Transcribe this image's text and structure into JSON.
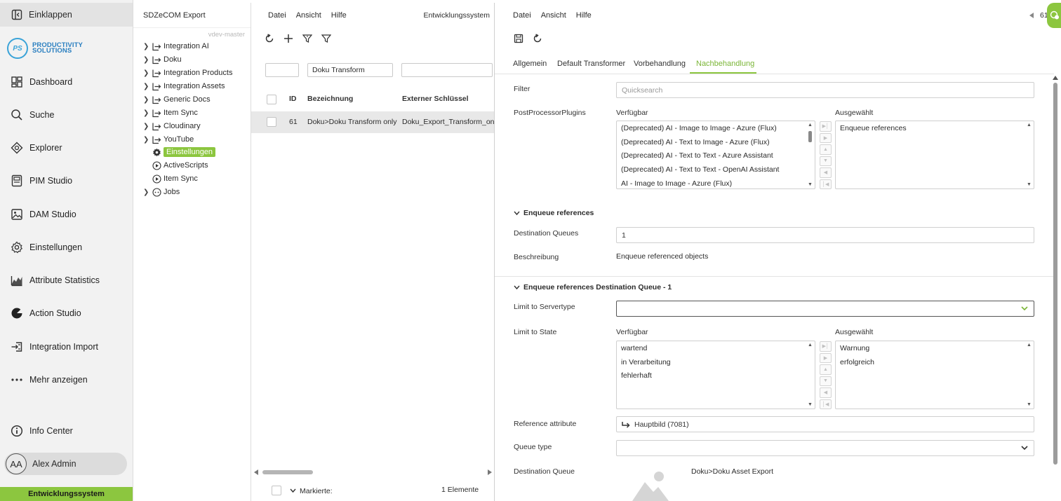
{
  "nav": {
    "collapse_label": "Einklappen",
    "logo_initials": "PS",
    "logo_line1": "PRODUCTIVITY",
    "logo_line2": "SOLUTIONS",
    "items": [
      {
        "label": "Dashboard",
        "icon": "dashboard-icon"
      },
      {
        "label": "Suche",
        "icon": "search-icon"
      },
      {
        "label": "Explorer",
        "icon": "explorer-icon"
      },
      {
        "label": "PIM Studio",
        "icon": "pim-studio-icon"
      },
      {
        "label": "DAM Studio",
        "icon": "image-icon"
      },
      {
        "label": "Einstellungen",
        "icon": "gear-icon"
      },
      {
        "label": "Attribute Statistics",
        "icon": "chart-icon"
      },
      {
        "label": "Action Studio",
        "icon": "action-studio-icon"
      },
      {
        "label": "Integration Import",
        "icon": "import-icon"
      },
      {
        "label": "Mehr anzeigen",
        "icon": "more-icon"
      }
    ],
    "info_center": "Info Center",
    "user_initials": "AA",
    "user_name": "Alex Admin",
    "environment": "Entwicklungssystem"
  },
  "tree": {
    "title": "SDZeCOM Export",
    "branch": "vdev-master",
    "items": [
      {
        "label": "Integration AI",
        "type": "folder"
      },
      {
        "label": "Doku",
        "type": "folder"
      },
      {
        "label": "Integration Products",
        "type": "folder"
      },
      {
        "label": "Integration Assets",
        "type": "folder"
      },
      {
        "label": "Generic Docs",
        "type": "folder"
      },
      {
        "label": "Item Sync",
        "type": "folder"
      },
      {
        "label": "Cloudinary",
        "type": "folder"
      },
      {
        "label": "YouTube",
        "type": "folder"
      },
      {
        "label": "Einstellungen",
        "type": "settings",
        "selected": true
      },
      {
        "label": "ActiveScripts",
        "type": "play"
      },
      {
        "label": "Item Sync",
        "type": "play"
      },
      {
        "label": "Jobs",
        "type": "jobs"
      }
    ]
  },
  "list": {
    "menu": [
      "Datei",
      "Ansicht",
      "Hilfe"
    ],
    "environment": "Entwicklungssystem",
    "filter_id": "",
    "filter_name": "Doku Transform",
    "filter_key": "",
    "columns": {
      "id": "ID",
      "name": "Bezeichnung",
      "key": "Externer Schlüssel"
    },
    "rows": [
      {
        "id": "61",
        "name": "Doku>Doku Transform only",
        "key": "Doku_Export_Transform_only"
      }
    ],
    "footer_marked": "Markierte:",
    "footer_count": "1 Elemente"
  },
  "detail": {
    "menu": [
      "Datei",
      "Ansicht",
      "Hilfe"
    ],
    "record_id": "61",
    "tabs": [
      "Allgemein",
      "Default Transformer",
      "Vorbehandlung",
      "Nachbehandlung"
    ],
    "active_tab": "Nachbehandlung",
    "filter_label": "Filter",
    "filter_placeholder": "Quicksearch",
    "plugins_label": "PostProcessorPlugins",
    "available_label": "Verfügbar",
    "selected_label": "Ausgewählt",
    "plugins_available": [
      "(Deprecated) AI - Image to Image - Azure (Flux)",
      "(Deprecated) AI - Text to Image - Azure (Flux)",
      "(Deprecated) AI - Text to Text - Azure Assistant",
      "(Deprecated) AI - Text to Text - OpenAI Assistant",
      "AI - Image to Image - Azure (Flux)"
    ],
    "plugins_selected": [
      "Enqueue references"
    ],
    "section1_title": "Enqueue references",
    "dest_queues_label": "Destination Queues",
    "dest_queues_value": "1",
    "description_label": "Beschreibung",
    "description_value": "Enqueue referenced objects",
    "section2_title": "Enqueue references Destination Queue - 1",
    "servertype_label": "Limit to Servertype",
    "servertype_value": "",
    "state_label": "Limit to State",
    "state_available": [
      "wartend",
      "in Verarbeitung",
      "fehlerhaft"
    ],
    "state_selected": [
      "Warnung",
      "erfolgreich"
    ],
    "ref_attr_label": "Reference attribute",
    "ref_attr_value": "Hauptbild (7081)",
    "queue_type_label": "Queue type",
    "queue_type_value": "",
    "dest_queue_label": "Destination Queue",
    "dest_queue_value": "Doku>Doku Asset Export"
  },
  "colors": {
    "accent": "#8cc63f",
    "accent_text": "#7ab536",
    "logo": "#2a7fc0"
  }
}
